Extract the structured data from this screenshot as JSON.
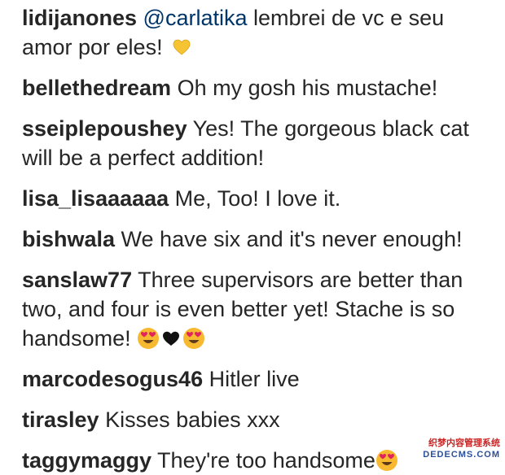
{
  "comments": [
    {
      "user": "lidijanones",
      "mention": "@carlatika",
      "text": " lembrei de vc e seu amor por eles! ",
      "emoji": "yellow-heart"
    },
    {
      "user": "bellethedream",
      "text": " Oh my gosh his mustache!"
    },
    {
      "user": "sseiplepoushey",
      "text": " Yes! The gorgeous black cat will be a perfect addition!"
    },
    {
      "user": "lisa_lisaaaaaa",
      "text": " Me, Too! I love it."
    },
    {
      "user": "bishwala",
      "text": " We have six and it's never enough!"
    },
    {
      "user": "sanslaw77",
      "text": " Three supervisors are better than two, and four is even better yet! Stache is so handsome! ",
      "emoji": "heart-eyes black-heart heart-eyes"
    },
    {
      "user": "marcodesogus46",
      "text": " Hitler live"
    },
    {
      "user": "tirasley",
      "text": " Kisses babies xxx"
    },
    {
      "user": "taggymaggy",
      "text": " They're too handsome",
      "emoji": "heart-eyes"
    }
  ],
  "watermark": {
    "line1": "织梦内容管理系统",
    "line2": "DEDECMS.COM"
  },
  "colors": {
    "text": "#262626",
    "mention": "#003569",
    "heart": "#f6c433",
    "face": "#f7b930",
    "eyes": "#e0245e"
  }
}
